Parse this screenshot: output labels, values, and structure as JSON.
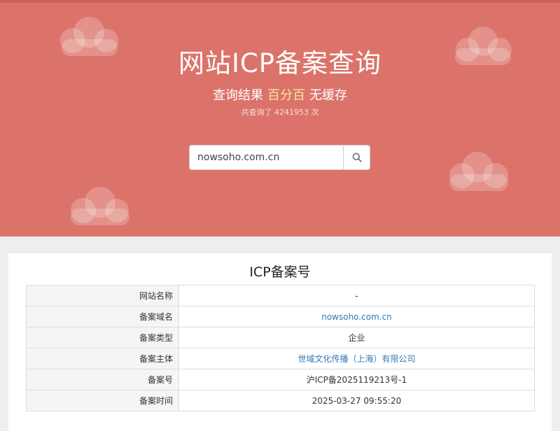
{
  "hero": {
    "title": "网站ICP备案查询",
    "subtitle_before": "查询结果",
    "subtitle_accent": "百分百",
    "subtitle_after": "无缓存",
    "count_text": "共查询了 4241953 次",
    "bg_color": "#dc736a",
    "accent_color": "#f3e5a0"
  },
  "search": {
    "value": "nowsoho.com.cn",
    "button_icon": "search-icon"
  },
  "result": {
    "title": "ICP备案号",
    "rows": [
      {
        "label": "网站名称",
        "value": "-"
      },
      {
        "label": "备案域名",
        "value": "nowsoho.com.cn"
      },
      {
        "label": "备案类型",
        "value": "企业"
      },
      {
        "label": "备案主体",
        "value": "世域文化传播（上海）有限公司"
      },
      {
        "label": "备案号",
        "value": "沪ICP备2025119213号-1"
      },
      {
        "label": "备案时间",
        "value": "2025-03-27 09:55:20"
      }
    ],
    "link_color": "#337ab7"
  }
}
